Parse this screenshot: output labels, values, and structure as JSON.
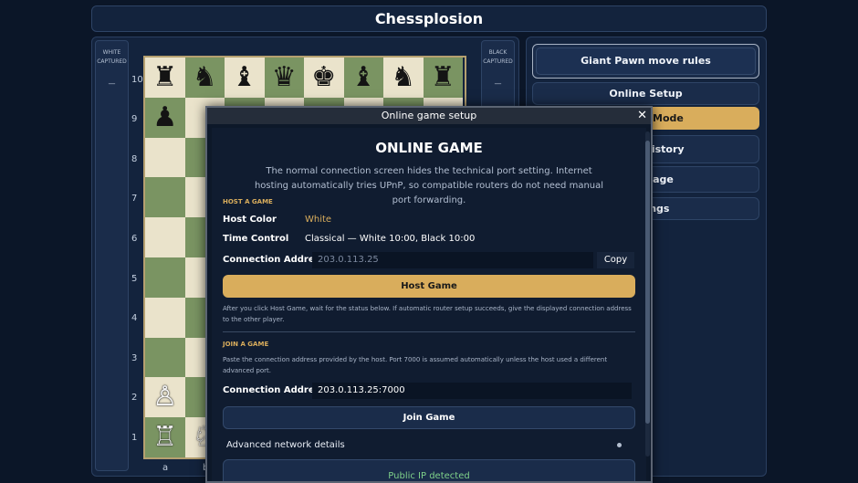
{
  "app": {
    "title": "Chessplosion"
  },
  "captured": {
    "white_label": "WHITE CAPTURED",
    "white_value": "—",
    "black_label": "BLACK CAPTURED",
    "black_value": "—"
  },
  "board": {
    "ranks": [
      "10",
      "9",
      "8",
      "7",
      "6",
      "5",
      "4",
      "3",
      "2",
      "1"
    ],
    "files": [
      "a",
      "b"
    ],
    "pieces": {
      "rank10": [
        "♜",
        "♞",
        "♝",
        "♛",
        "♚",
        "♝",
        "♞",
        "♜"
      ],
      "rank9": [
        "♟"
      ],
      "rank2": [
        "♙"
      ],
      "rank1": [
        "♖",
        "♘"
      ]
    }
  },
  "menu": {
    "giant_pawn": "Giant Pawn move rules",
    "online_setup": "Online Setup",
    "choose_mode": "Choose Mode",
    "game_history": "Game History",
    "language": "Language",
    "settings": "Settings"
  },
  "modal": {
    "header": "Online game setup",
    "close": "✕",
    "title": "ONLINE GAME",
    "description": "The normal connection screen hides the technical port setting. Internet hosting automatically tries UPnP, so compatible routers do not need manual port forwarding.",
    "host": {
      "section_label": "HOST A GAME",
      "color_label": "Host Color",
      "color_value": "White",
      "time_label": "Time Control",
      "time_value": "Classical — White 10:00, Black 10:00",
      "address_label": "Connection Address",
      "address_value": "203.0.113.25",
      "copy_label": "Copy",
      "host_button": "Host Game",
      "note": "After you click Host Game, wait for the status below. If automatic router setup succeeds, give the displayed connection address to the other player."
    },
    "join": {
      "section_label": "JOIN A GAME",
      "note": "Paste the connection address provided by the host. Port 7000 is assumed automatically unless the host used a different advanced port.",
      "address_label": "Connection Address",
      "address_value": "203.0.113.25:7000",
      "join_button": "Join Game"
    },
    "advanced_label": "Advanced network details",
    "advanced_enabled": false,
    "public_ip": "Public IP detected"
  },
  "colors": {
    "accent_gold": "#d9ad5c",
    "background": "#0b1628",
    "board_light": "#eae3cb",
    "board_dark": "#7a9462",
    "status_green": "#7fd18a"
  }
}
